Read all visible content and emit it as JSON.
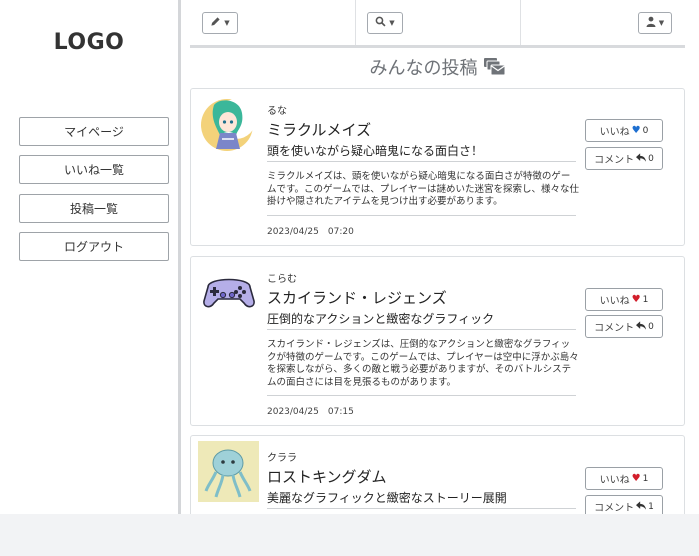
{
  "sidebar": {
    "logo": "LOGO",
    "nav": [
      "マイページ",
      "いいね一覧",
      "投稿一覧",
      "ログアウト"
    ]
  },
  "topbar": {
    "buttons": [
      "pencil-icon",
      "search-icon",
      "user-icon"
    ]
  },
  "heading": "みんなの投稿",
  "colors": {
    "like_blue": "#1e6fd0",
    "like_red": "#d21e2b",
    "border": "#dcdfe2"
  },
  "posts": [
    {
      "user": "るな",
      "title": "ミラクルメイズ",
      "subtitle": "頭を使いながら疑心暗鬼になる面白さ！",
      "body": "ミラクルメイズは、頭を使いながら疑心暗鬼になる面白さが特徴のゲームです。このゲームでは、プレイヤーは謎めいた迷宮を探索し、様々な仕掛けや隠されたアイテムを見つけ出す必要があります。",
      "date": "2023/04/25　07:20",
      "like_label": "いいね",
      "like_count": "0",
      "liked": false,
      "comment_label": "コメント",
      "comment_count": "0"
    },
    {
      "user": "こらむ",
      "title": "スカイランド・レジェンズ",
      "subtitle": "圧倒的なアクションと緻密なグラフィック",
      "body": "スカイランド・レジェンズは、圧倒的なアクションと緻密なグラフィックが特徴のゲームです。このゲームでは、プレイヤーは空中に浮かぶ島々を探索しながら、多くの敵と戦う必要がありますが、そのバトルシステムの面白さには目を見張るものがあります。",
      "date": "2023/04/25　07:15",
      "like_label": "いいね",
      "like_count": "1",
      "liked": true,
      "comment_label": "コメント",
      "comment_count": "0"
    },
    {
      "user": "クララ",
      "title": "ロストキングダム",
      "subtitle": "美麗なグラフィックと緻密なストーリー展開",
      "body": "",
      "date": "",
      "like_label": "いいね",
      "like_count": "1",
      "liked": true,
      "comment_label": "コメント",
      "comment_count": "1"
    }
  ]
}
